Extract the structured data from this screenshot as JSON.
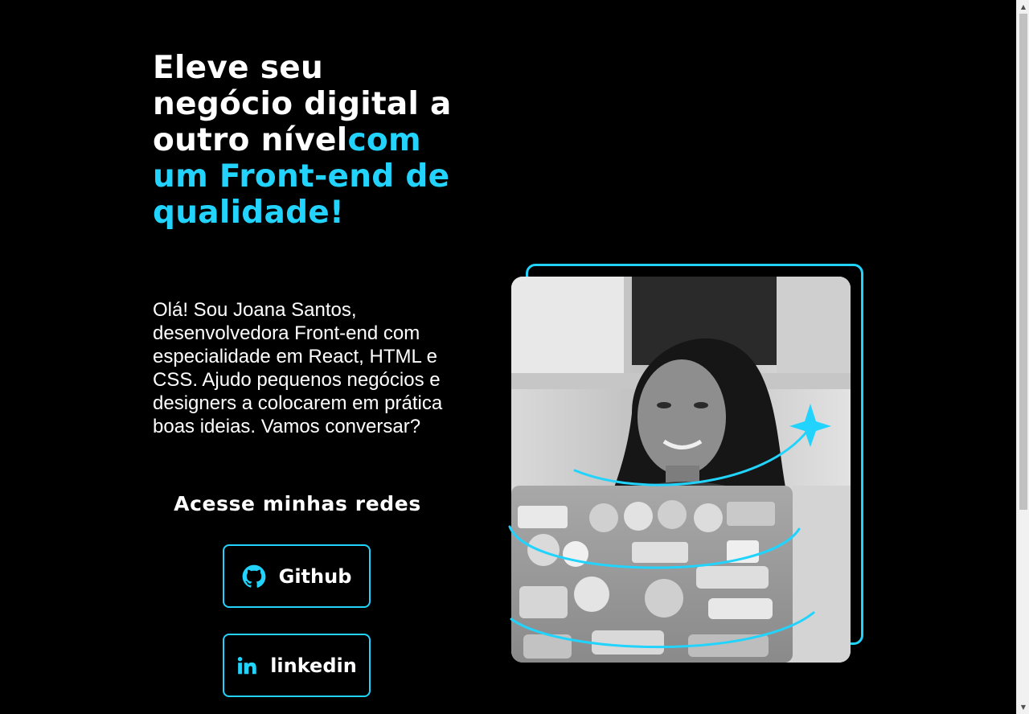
{
  "hero": {
    "title_white": "Eleve seu negócio digital a outro nível",
    "title_accent": "com um Front-end de qualidade!",
    "bio": "Olá! Sou Joana Santos, desenvolvedora Front-end com especialidade em React, HTML e CSS. Ajudo pequenos negócios e designers a colocarem em prática boas ideias. Vamos conversar?"
  },
  "social": {
    "heading": "Acesse minhas redes",
    "links": [
      {
        "label": "Github",
        "icon": "github-icon"
      },
      {
        "label": "linkedin",
        "icon": "linkedin-icon"
      }
    ]
  },
  "photo": {
    "description_icon": "portrait-photo",
    "sparkle_icon": "sparkle-icon"
  },
  "colors": {
    "background": "#000000",
    "accent": "#22d4fd",
    "text": "#ffffff"
  }
}
